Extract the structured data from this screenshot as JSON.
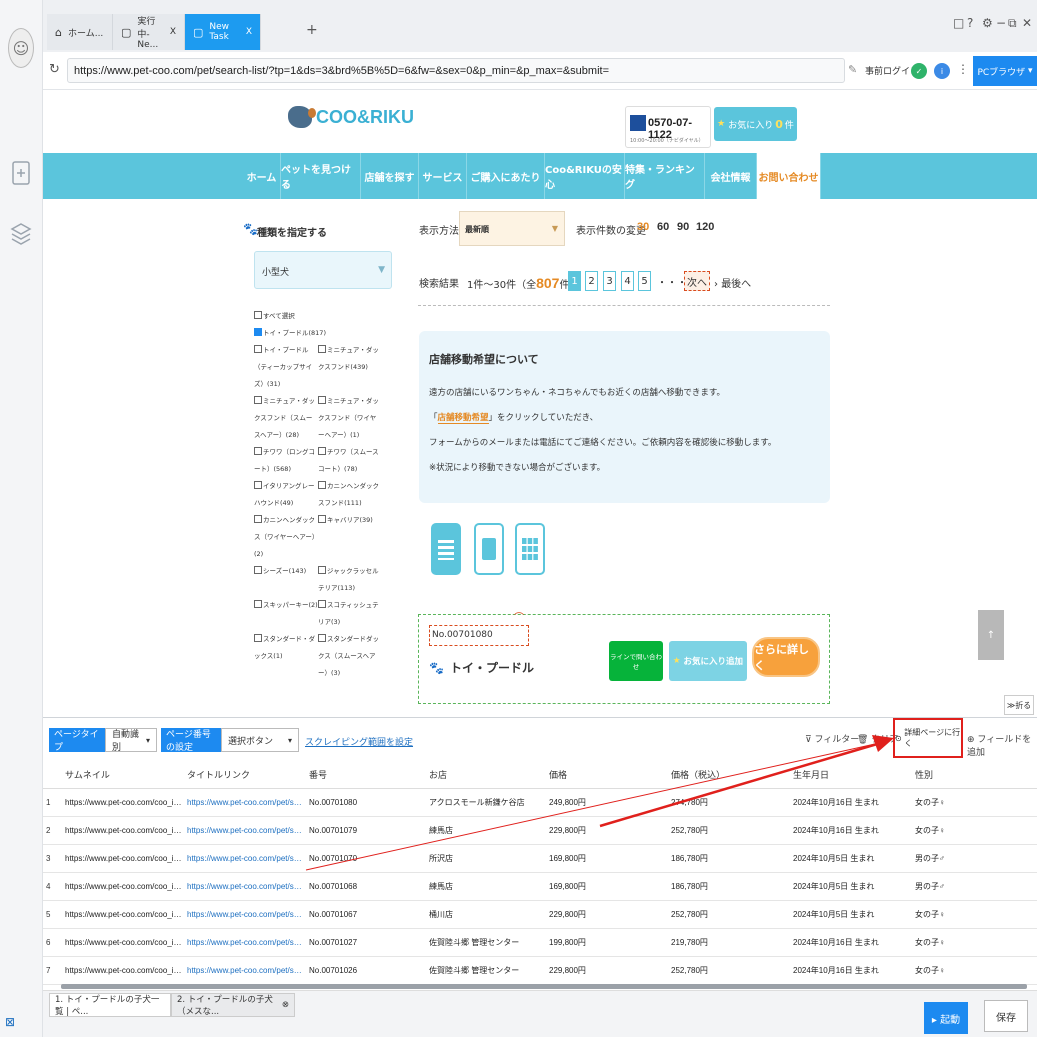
{
  "browser": {
    "tabs": [
      {
        "label": "ホーム..."
      },
      {
        "label": "実行中-Ne...",
        "close": "X"
      },
      {
        "label": "New Task",
        "close": "X"
      }
    ],
    "new_tab": "+",
    "url": "https://www.pet-coo.com/pet/search-list/?tp=1&ds=3&brd%5B%5D=6&fw=&sex=0&p_min=&p_max=&submit=",
    "login_label": "事前ログイン",
    "pc_browser": "PCブラウザ",
    "window_controls": [
      "□",
      "?",
      "⚙",
      "−",
      "⧉",
      "✕"
    ]
  },
  "site": {
    "logo": "COO&RIKU",
    "phone": "0570-07-1122",
    "phone_sub": "10:00〜20:00（ナビダイヤル）",
    "fav_label": "お気に入り",
    "fav_count": "0",
    "fav_unit": "件",
    "nav": [
      "ホーム",
      "ペットを見つける",
      "店舗を探す",
      "サービス",
      "ご購入にあたり",
      "Coo&RIKUの安心",
      "特集・ランキング",
      "会社情報",
      "お問い合わせ"
    ],
    "filter": {
      "heading": "種類を指定する",
      "selected": "小型犬",
      "checkboxes": [
        {
          "label": "すべて選択",
          "checked": false
        },
        {
          "label": "トイ・プードル(817)",
          "checked": true
        },
        {
          "label": "トイ・プードル（ティーカップサイズ）(31)",
          "checked": false
        },
        {
          "label": "ミニチュア・ダックスフンド(439)",
          "checked": false
        },
        {
          "label": "ミニチュア・ダックスフンド（スムースヘアー）(28)",
          "checked": false
        },
        {
          "label": "ミニチュア・ダックスフンド（ワイヤーヘアー）(1)",
          "checked": false
        },
        {
          "label": "チワワ（ロングコート）(568)",
          "checked": false
        },
        {
          "label": "チワワ（スムースコート）(78)",
          "checked": false
        },
        {
          "label": "イタリアングレーハウンド(49)",
          "checked": false
        },
        {
          "label": "カニンヘンダックスフンド(111)",
          "checked": false
        },
        {
          "label": "カニンヘンダックス（ワイヤーヘアー）(2)",
          "checked": false
        },
        {
          "label": "キャバリア(39)",
          "checked": false
        },
        {
          "label": "シーズー(143)",
          "checked": false
        },
        {
          "label": "ジャックラッセルテリア(113)",
          "checked": false
        },
        {
          "label": "スキッパーキー(2)",
          "checked": false
        },
        {
          "label": "スコティッシュテリア(3)",
          "checked": false
        },
        {
          "label": "スタンダード・ダックス(1)",
          "checked": false
        },
        {
          "label": "スタンダードダックス（スムースヘアー）(3)",
          "checked": false
        }
      ]
    },
    "display": {
      "method_label": "表示方法",
      "sort_value": "最新順",
      "count_label": "表示件数の変更",
      "counts": [
        "30",
        "60",
        "90",
        "120"
      ],
      "result_label": "検索結果",
      "result_text_pre": "1件〜30件（全",
      "result_total": "807",
      "result_text_post": "件）",
      "pages": [
        "1",
        "2",
        "3",
        "4",
        "5"
      ],
      "ellipsis": "・・・",
      "next": "次へ",
      "last": "最後へ"
    },
    "info": {
      "title": "店舗移動希望について",
      "line1": "遠方の店舗にいるワンちゃん・ネコちゃんでもお近くの店舗へ移動できます。",
      "line2_pre": "「",
      "line2_link": "店舗移動希望",
      "line2_post": "」をクリックしていただき、",
      "line3": "フォームからのメールまたは電話にてご連絡ください。ご依頼内容を確認後に移動します。",
      "line4": "※状況により移動できない場合がございます。"
    },
    "card": {
      "number": "No.00701080",
      "title": "トイ・プードル",
      "line_btn": "ラインで問い合わせ",
      "fav_btn": "お気に入り追加",
      "detail_btn": "さらに詳しく"
    },
    "fold_label": "≫折る"
  },
  "panel": {
    "page_type_label": "ページタイプ",
    "page_type_value": "自動識別",
    "page_num_label": "ページ番号の設定",
    "page_num_value": "選択ボタン",
    "scope_link": "スクレイピング範囲を設定",
    "filter_label": "フィルター",
    "clear_label": "クリア",
    "goto_detail": "詳細ページに行く",
    "add_field": "フィールドを追加",
    "columns": [
      "サムネイル",
      "タイトルリンク",
      "番号",
      "お店",
      "価格",
      "価格（税込）",
      "生年月日",
      "性別"
    ],
    "rows": [
      {
        "idx": "1",
        "thumb": "https://www.pet-coo.com/coo_image/...",
        "link": "https://www.pet-coo.com/pet/search-d...",
        "no": "No.00701080",
        "shop": "アクロスモール新鎌ケ谷店",
        "price": "249,800円",
        "price_tax": "274,780円",
        "birth": "2024年10月16日 生まれ",
        "sex": "女の子♀"
      },
      {
        "idx": "2",
        "thumb": "https://www.pet-coo.com/coo_image/...",
        "link": "https://www.pet-coo.com/pet/search-d...",
        "no": "No.00701079",
        "shop": "練馬店",
        "price": "229,800円",
        "price_tax": "252,780円",
        "birth": "2024年10月16日 生まれ",
        "sex": "女の子♀"
      },
      {
        "idx": "3",
        "thumb": "https://www.pet-coo.com/coo_image/...",
        "link": "https://www.pet-coo.com/pet/search-d...",
        "no": "No.00701070",
        "shop": "所沢店",
        "price": "169,800円",
        "price_tax": "186,780円",
        "birth": "2024年10月5日 生まれ",
        "sex": "男の子♂"
      },
      {
        "idx": "4",
        "thumb": "https://www.pet-coo.com/coo_image/...",
        "link": "https://www.pet-coo.com/pet/search-d...",
        "no": "No.00701068",
        "shop": "練馬店",
        "price": "169,800円",
        "price_tax": "186,780円",
        "birth": "2024年10月5日 生まれ",
        "sex": "男の子♂"
      },
      {
        "idx": "5",
        "thumb": "https://www.pet-coo.com/coo_image/...",
        "link": "https://www.pet-coo.com/pet/search-d...",
        "no": "No.00701067",
        "shop": "桶川店",
        "price": "229,800円",
        "price_tax": "252,780円",
        "birth": "2024年10月5日 生まれ",
        "sex": "女の子♀"
      },
      {
        "idx": "6",
        "thumb": "https://www.pet-coo.com/coo_image/...",
        "link": "https://www.pet-coo.com/pet/search-d...",
        "no": "No.00701027",
        "shop": "佐賀陸斗郷 管理センター",
        "price": "199,800円",
        "price_tax": "219,780円",
        "birth": "2024年10月16日 生まれ",
        "sex": "女の子♀"
      },
      {
        "idx": "7",
        "thumb": "https://www.pet-coo.com/coo_image/...",
        "link": "https://www.pet-coo.com/pet/search-d...",
        "no": "No.00701026",
        "shop": "佐賀陸斗郷 管理センター",
        "price": "229,800円",
        "price_tax": "252,780円",
        "birth": "2024年10月16日 生まれ",
        "sex": "女の子♀"
      }
    ],
    "bottom_tabs": [
      "1. トイ・プードルの子犬一覧 | ペ...",
      "2. トイ・プードルの子犬（メスな..."
    ],
    "run_label": "▸ 起動",
    "save_label": "保存"
  },
  "colors": {
    "accent": "#1d8af0",
    "site_nav": "#5bc5dc",
    "highlight": "#e0201c",
    "orange": "#e58a24"
  }
}
